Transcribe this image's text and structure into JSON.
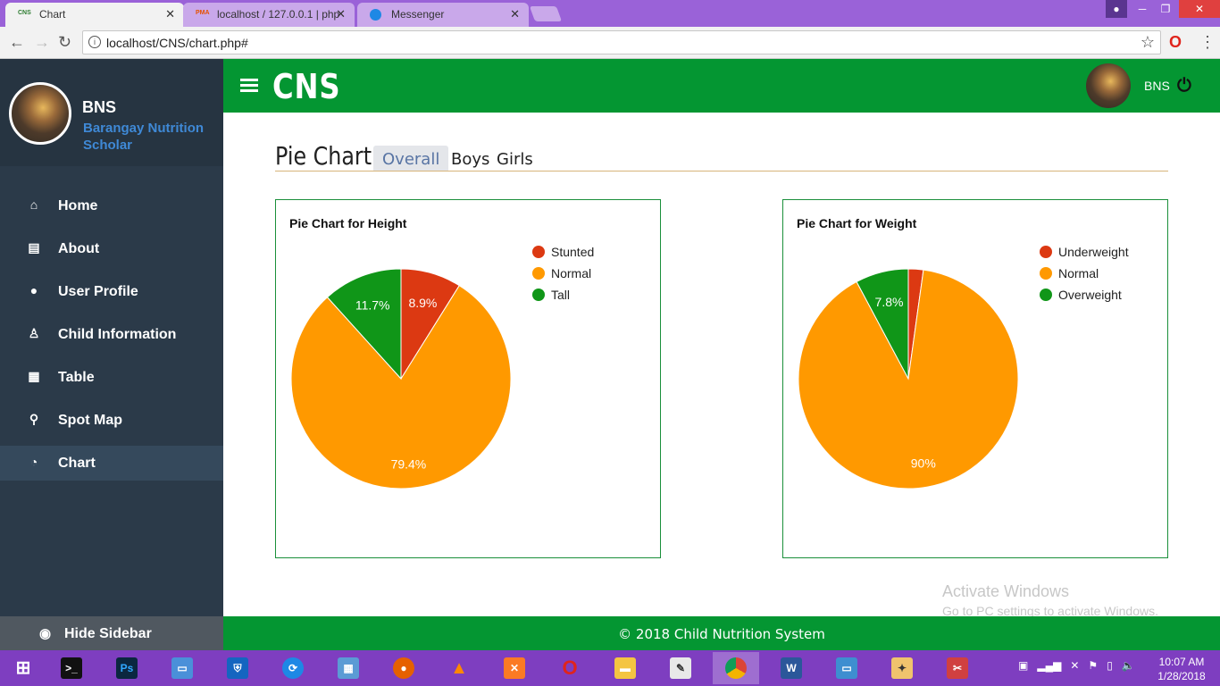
{
  "browser": {
    "tabs": [
      {
        "favicon": "CNS",
        "label": "Chart",
        "active": true
      },
      {
        "favicon": "PMA",
        "label": "localhost / 127.0.0.1 | php",
        "active": false
      },
      {
        "favicon": "messenger-icon",
        "label": "Messenger",
        "active": false
      }
    ],
    "url": "localhost/CNS/chart.php#"
  },
  "sidebar": {
    "profile_name": "BNS",
    "profile_role": "Barangay Nutrition Scholar",
    "items": [
      {
        "label": "Home",
        "icon": "home-icon",
        "glyph": "⌂"
      },
      {
        "label": "About",
        "icon": "book-icon",
        "glyph": "▤"
      },
      {
        "label": "User Profile",
        "icon": "user-icon",
        "glyph": "●"
      },
      {
        "label": "Child Information",
        "icon": "child-icon",
        "glyph": "♙"
      },
      {
        "label": "Table",
        "icon": "table-icon",
        "glyph": "▦"
      },
      {
        "label": "Spot Map",
        "icon": "map-marker-icon",
        "glyph": "⚲"
      },
      {
        "label": "Chart",
        "icon": "pie-chart-icon",
        "glyph": "◔",
        "active": true
      }
    ],
    "hide_label": "Hide Sidebar"
  },
  "header": {
    "brand": "CNS",
    "user": "BNS"
  },
  "main": {
    "title": "Pie Chart",
    "tabs": [
      "Overall",
      "Boys",
      "Girls"
    ],
    "active_tab": "Overall"
  },
  "colors": {
    "header_green": "#049632",
    "sidebar": "#2b3a49",
    "slice_red": "#dc3912",
    "slice_orange": "#ff9900",
    "slice_green": "#109618"
  },
  "chart_data": [
    {
      "type": "pie",
      "title": "Pie Chart for Height",
      "categories": [
        "Stunted",
        "Normal",
        "Tall"
      ],
      "values": [
        8.9,
        79.4,
        11.7
      ],
      "labels": [
        "8.9%",
        "79.4%",
        "11.7%"
      ],
      "colors": [
        "#dc3912",
        "#ff9900",
        "#109618"
      ],
      "legend": "right"
    },
    {
      "type": "pie",
      "title": "Pie Chart for Weight",
      "categories": [
        "Underweight",
        "Normal",
        "Overweight"
      ],
      "values": [
        2.2,
        90,
        7.8
      ],
      "labels": [
        "",
        "90%",
        "7.8%"
      ],
      "colors": [
        "#dc3912",
        "#ff9900",
        "#109618"
      ],
      "legend": "right"
    }
  ],
  "watermark": {
    "title": "Activate Windows",
    "subtitle": "Go to PC settings to activate Windows."
  },
  "footer": "© 2018 Child Nutrition System",
  "taskbar": {
    "time": "10:07 AM",
    "date": "1/28/2018"
  }
}
